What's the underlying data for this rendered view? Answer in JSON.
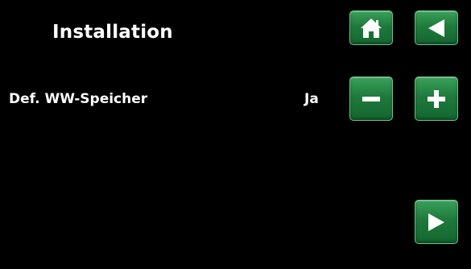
{
  "header": {
    "title": "Installation"
  },
  "setting": {
    "label": "Def. WW-Speicher",
    "value": "Ja"
  },
  "icons": {
    "home": "home-icon",
    "back": "arrow-left-icon",
    "minus": "minus-icon",
    "plus": "plus-icon",
    "next": "arrow-right-icon"
  },
  "colors": {
    "background": "#000000",
    "text": "#ffffff",
    "button": "#1f7a3c",
    "button_border": "#6fbf8f"
  }
}
